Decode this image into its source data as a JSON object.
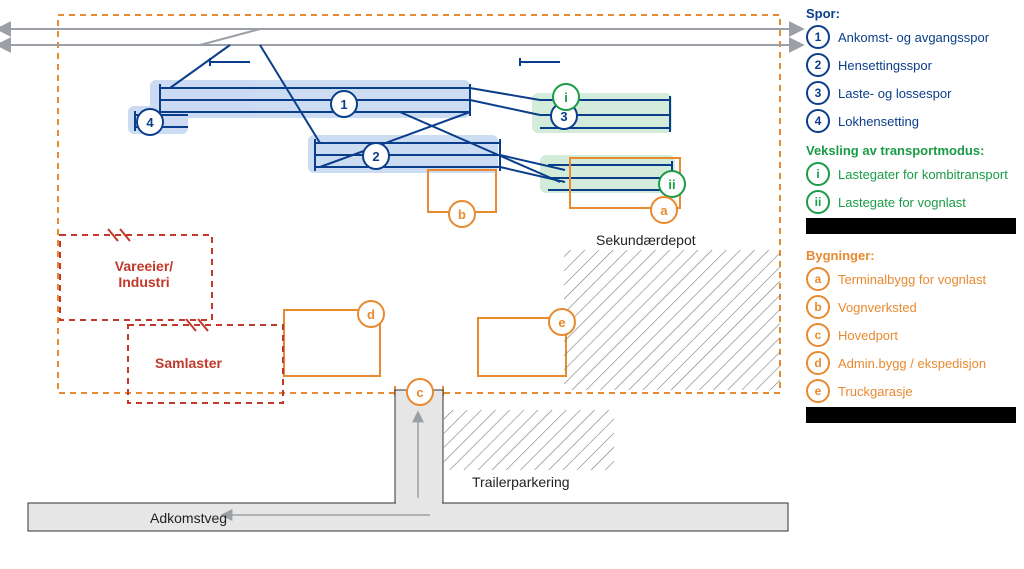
{
  "legend": {
    "spor": {
      "title": "Spor:",
      "items": [
        {
          "id": "1",
          "label": "Ankomst- og avgangsspor"
        },
        {
          "id": "2",
          "label": "Hensettingsspor"
        },
        {
          "id": "3",
          "label": "Laste- og lossespor"
        },
        {
          "id": "4",
          "label": "Lokhensetting"
        }
      ]
    },
    "veksling": {
      "title": "Veksling av transportmodus:",
      "items": [
        {
          "id": "i",
          "label": "Lastegater for kombitransport"
        },
        {
          "id": "ii",
          "label": "Lastegate for vognlast"
        }
      ]
    },
    "bygninger": {
      "title": "Bygninger:",
      "items": [
        {
          "id": "a",
          "label": "Terminalbygg for vognlast"
        },
        {
          "id": "b",
          "label": "Vognverksted"
        },
        {
          "id": "c",
          "label": "Hovedport"
        },
        {
          "id": "d",
          "label": "Admin.bygg / ekspedisjon"
        },
        {
          "id": "e",
          "label": "Truckgarasje"
        }
      ]
    }
  },
  "diagram": {
    "vareeier_label": "Vareeier/\nIndustri",
    "samlaster_label": "Samlaster",
    "sekundardepot_label": "Sekundærdepot",
    "trailerparkering_label": "Trailerparkering",
    "adkomstveg_label": "Adkomstveg",
    "track_badges": {
      "b1": "1",
      "b2": "2",
      "b3": "3",
      "b4": "4"
    },
    "green_badges": {
      "gi": "i",
      "gii": "ii"
    },
    "building_badges": {
      "a": "a",
      "b": "b",
      "c": "c",
      "d": "d",
      "e": "e"
    }
  },
  "colors": {
    "blue": "#0b3e8a",
    "blue_fill": "#c7d8f2",
    "green": "#1a9b46",
    "green_fill": "#cfead7",
    "orange": "#e88a2f",
    "red": "#c0392b",
    "grey_road": "#e6e6e6",
    "grey_line": "#9aa0a5"
  }
}
